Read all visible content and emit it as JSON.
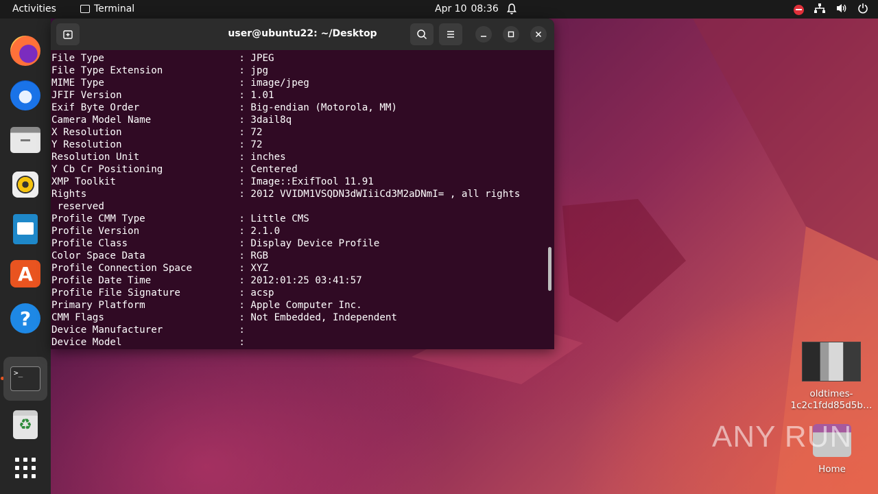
{
  "topbar": {
    "activities": "Activities",
    "app_name": "Terminal",
    "date": "Apr 10",
    "time": "08:36"
  },
  "dock": {
    "items": [
      "firefox-icon",
      "thunderbird-icon",
      "files-icon",
      "rhythmbox-icon",
      "libreoffice-impress-icon",
      "app-center-icon",
      "help-icon",
      "terminal-icon",
      "trash-icon",
      "show-apps-icon"
    ],
    "terminal_prompt": ">_"
  },
  "terminal": {
    "title": "user@ubuntu22: ~/Desktop",
    "lines": [
      {
        "key": "File Type",
        "value": "JPEG"
      },
      {
        "key": "File Type Extension",
        "value": "jpg"
      },
      {
        "key": "MIME Type",
        "value": "image/jpeg"
      },
      {
        "key": "JFIF Version",
        "value": "1.01"
      },
      {
        "key": "Exif Byte Order",
        "value": "Big-endian (Motorola, MM)"
      },
      {
        "key": "Camera Model Name",
        "value": "3dail8q"
      },
      {
        "key": "X Resolution",
        "value": "72"
      },
      {
        "key": "Y Resolution",
        "value": "72"
      },
      {
        "key": "Resolution Unit",
        "value": "inches"
      },
      {
        "key": "Y Cb Cr Positioning",
        "value": "Centered"
      },
      {
        "key": "XMP Toolkit",
        "value": "Image::ExifTool 11.91"
      },
      {
        "key": "Rights",
        "value": "2012 VVIDM1VSQDN3dWIiiCd3M2aDNmI= , all rights"
      },
      {
        "key": "",
        "value": "reserved",
        "continuation": true
      },
      {
        "key": "Profile CMM Type",
        "value": "Little CMS"
      },
      {
        "key": "Profile Version",
        "value": "2.1.0"
      },
      {
        "key": "Profile Class",
        "value": "Display Device Profile"
      },
      {
        "key": "Color Space Data",
        "value": "RGB"
      },
      {
        "key": "Profile Connection Space",
        "value": "XYZ"
      },
      {
        "key": "Profile Date Time",
        "value": "2012:01:25 03:41:57"
      },
      {
        "key": "Profile File Signature",
        "value": "acsp"
      },
      {
        "key": "Primary Platform",
        "value": "Apple Computer Inc."
      },
      {
        "key": "CMM Flags",
        "value": "Not Embedded, Independent"
      },
      {
        "key": "Device Manufacturer",
        "value": ""
      },
      {
        "key": "Device Model",
        "value": ""
      }
    ]
  },
  "desktop": {
    "file_icon_label_line1": "oldtimes-",
    "file_icon_label_line2": "1c2c1fdd85d5b…",
    "home_label": "Home"
  },
  "watermark": "ANY RUN",
  "colors": {
    "terminal_bg": "#300a24",
    "header_bg": "#2c2c2c",
    "accent": "#e95420"
  }
}
